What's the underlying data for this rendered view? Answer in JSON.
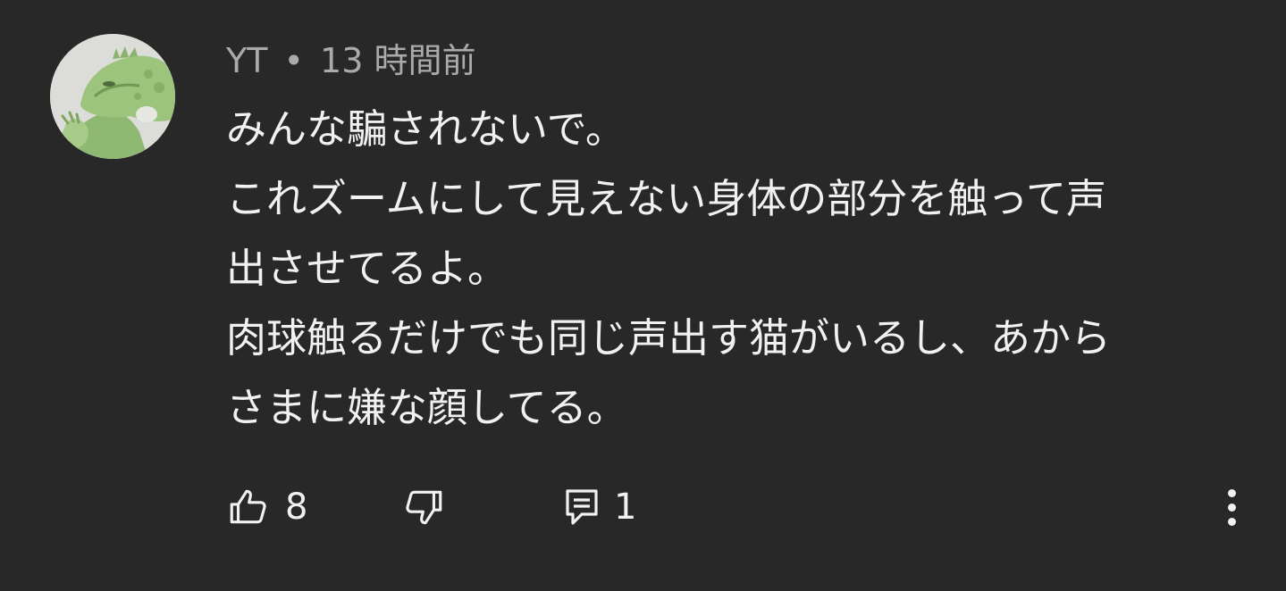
{
  "comment": {
    "author": "YT",
    "separator": "•",
    "timestamp": "13 時間前",
    "lines": [
      "みんな騙されないで。",
      "これズームにして見えない身体の部分を触って声",
      "出させてるよ。",
      "肉球触るだけでも同じ声出す猫がいるし、あから",
      "さまに嫌な顔してる。"
    ],
    "avatar_icon": "iguana-avatar"
  },
  "actions": {
    "like_icon": "thumbs-up-icon",
    "like_count": "8",
    "dislike_icon": "thumbs-down-icon",
    "reply_icon": "comment-reply-icon",
    "reply_count": "1",
    "more_icon": "more-vertical-icon"
  },
  "colors": {
    "background": "#282828",
    "text": "#f1f1f1",
    "meta_text": "#aaaaaa"
  }
}
